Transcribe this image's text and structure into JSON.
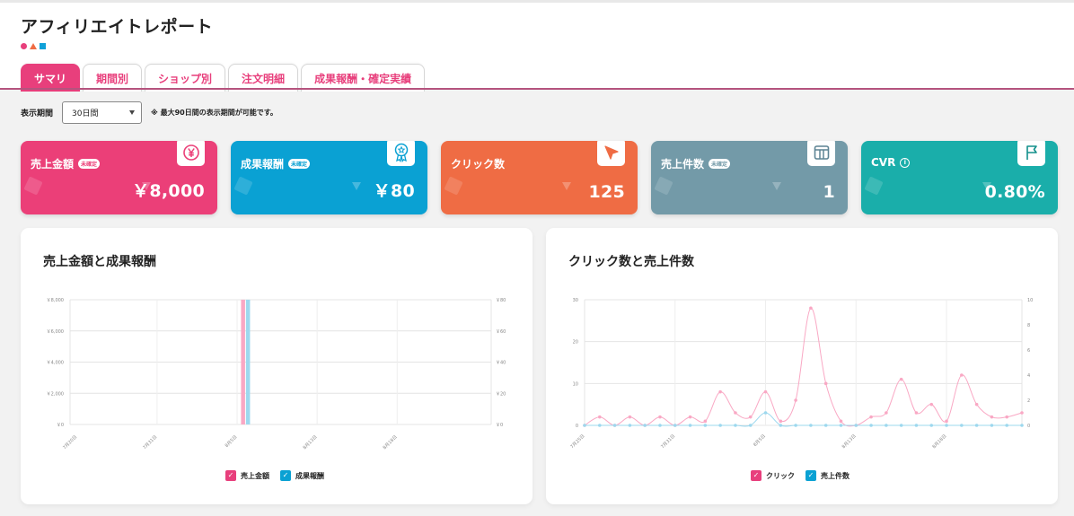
{
  "header": {
    "title": "アフィリエイトレポート",
    "deco_colors": [
      "#e83f7c",
      "#ef6c44",
      "#10a1d8"
    ]
  },
  "tabs": [
    {
      "label": "サマリ",
      "active": true
    },
    {
      "label": "期間別",
      "active": false
    },
    {
      "label": "ショップ別",
      "active": false
    },
    {
      "label": "注文明細",
      "active": false
    },
    {
      "label": "成果報酬・確定実績",
      "active": false
    }
  ],
  "period": {
    "label": "表示期間",
    "selected": "30日間",
    "note": "※ 最大90日間の表示期間が可能です。"
  },
  "cards": [
    {
      "label": "売上金額",
      "badge": "未確定",
      "value": "￥8,000",
      "icon": "yen-icon",
      "color": "#eb3f78"
    },
    {
      "label": "成果報酬",
      "badge": "未確定",
      "value": "￥80",
      "icon": "award-ribbon-icon",
      "color": "#0aa1d3"
    },
    {
      "label": "クリック数",
      "badge": "",
      "value": "125",
      "icon": "cursor-arrow-icon",
      "color": "#ef6c44"
    },
    {
      "label": "売上件数",
      "badge": "未確定",
      "value": "1",
      "icon": "columns-icon",
      "color": "#739aa8"
    },
    {
      "label": "CVR",
      "badge": "",
      "info": "i",
      "value": "0.80%",
      "icon": "flag-icon",
      "color": "#1aaeaa"
    }
  ],
  "charts": {
    "sales": {
      "title": "売上金額と成果報酬",
      "legend": [
        "売上金額",
        "成果報酬"
      ],
      "colors": [
        "#f9a8c4",
        "#9dd8ee"
      ]
    },
    "clicks": {
      "title": "クリック数と売上件数",
      "legend": [
        "クリック",
        "売上件数"
      ],
      "colors": [
        "#f9a8c4",
        "#9dd8ee"
      ]
    }
  },
  "chart_data": [
    {
      "type": "bar",
      "title": "売上金額と成果報酬",
      "x_ticks": [
        "7月20日",
        "7月31日",
        "8月5日",
        "8月13日",
        "8月18日"
      ],
      "y_left_ticks": [
        "￥0",
        "￥2,000",
        "￥4,000",
        "￥6,000",
        "￥8,000"
      ],
      "y_right_ticks": [
        "￥0",
        "￥20",
        "￥40",
        "￥60",
        "￥80"
      ],
      "ylim_left": [
        0,
        8000
      ],
      "ylim_right": [
        0,
        80
      ],
      "category_count": 30,
      "bar_index": 12,
      "series": [
        {
          "name": "売上金額",
          "index": 12,
          "value": 8000,
          "axis": "left"
        },
        {
          "name": "成果報酬",
          "index": 12,
          "value": 80,
          "axis": "right"
        }
      ],
      "grid": true,
      "legend_position": "bottom"
    },
    {
      "type": "line",
      "title": "クリック数と売上件数",
      "x_ticks": [
        "7月25日",
        "7月31日",
        "8月5日",
        "8月13日",
        "8月18日"
      ],
      "y_left_ticks": [
        "0",
        "10",
        "20",
        "30"
      ],
      "y_right_ticks": [
        "0",
        "2",
        "4",
        "6",
        "8",
        "10"
      ],
      "ylim_left": [
        0,
        30
      ],
      "ylim_right": [
        0,
        10
      ],
      "series": [
        {
          "name": "クリック",
          "axis": "left",
          "values": [
            0,
            2,
            0,
            2,
            0,
            2,
            0,
            2,
            1,
            8,
            3,
            2,
            8,
            1,
            6,
            28,
            10,
            1,
            0,
            2,
            3,
            11,
            3,
            5,
            1,
            12,
            5,
            2,
            2,
            3
          ]
        },
        {
          "name": "売上件数",
          "axis": "right",
          "values": [
            0,
            0,
            0,
            0,
            0,
            0,
            0,
            0,
            0,
            0,
            0,
            0,
            1,
            0,
            0,
            0,
            0,
            0,
            0,
            0,
            0,
            0,
            0,
            0,
            0,
            0,
            0,
            0,
            0,
            0
          ]
        }
      ],
      "grid": true,
      "legend_position": "bottom"
    }
  ]
}
